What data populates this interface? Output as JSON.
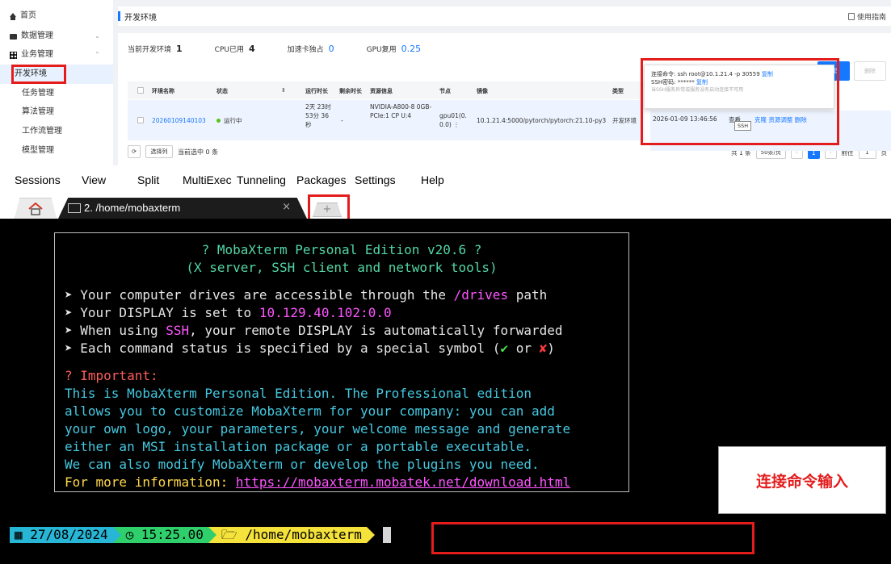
{
  "sidebar": {
    "items": [
      {
        "label": "首页",
        "icon": "home-icon"
      },
      {
        "label": "数据管理",
        "icon": "folder-icon"
      },
      {
        "label": "业务管理",
        "icon": "grid-icon"
      },
      {
        "label": "开发环境"
      },
      {
        "label": "任务管理"
      },
      {
        "label": "算法管理"
      },
      {
        "label": "工作流管理"
      },
      {
        "label": "模型管理"
      }
    ]
  },
  "header": {
    "title": "开发环境",
    "help": "使用指南"
  },
  "stats": {
    "env_label": "当前开发环境",
    "env_value": "1",
    "cpu_label": "CPU已用",
    "cpu_value": "4",
    "acc_label": "加速卡独占",
    "acc_value": "0",
    "gpu_label": "GPU复用",
    "gpu_value": "0.25"
  },
  "table": {
    "headers": [
      "环境名称",
      "状态",
      "运行时长",
      "剩余时长",
      "资源信息",
      "节点",
      "镜像",
      "类型"
    ],
    "row": {
      "name": "20260109140103",
      "status": "运行中",
      "runtime": "2天 23时 53分 36 秒",
      "remaining": "-",
      "resource": "NVIDIA-A800-8 0GB-PCIe:1 CP U:4",
      "node": "gpu01(0. 0.0) ⋮",
      "image": "10.1.21.4:5000/pytorch/pytorch:21.10-py3",
      "type": "开发环境",
      "created": "2026-01-09 13:46:56",
      "view": "查看",
      "actions": "克隆 资源调整 删除"
    }
  },
  "popup": {
    "cmd_label": "连接命令:",
    "cmd_value": "ssh root@10.1.21.4 -p 30559",
    "copy": "复制",
    "pwd_label": "SSH密码:",
    "pwd_value": "******",
    "hint": "当SSH服务异常或服务没有启动连接不可用"
  },
  "tooltip": "SSH",
  "buttons": {
    "create": "新建",
    "delete": "删除"
  },
  "footer": {
    "refresh": "⟳",
    "select_col": "选择列",
    "selected": "当前选中 0 条",
    "total": "共 1 条",
    "page_size": "50条/页",
    "page": "1",
    "goto": "前往",
    "goto_value": "1",
    "page_suffix": "页"
  },
  "menubar": [
    "Sessions",
    "View",
    "Split",
    "MultiExec",
    "Tunneling",
    "Packages",
    "Settings",
    "Help"
  ],
  "tabs": {
    "term_label": "2. /home/mobaxterm",
    "close": "×",
    "new": "+"
  },
  "banner": {
    "title": "? MobaXterm Personal Edition v20.6 ?",
    "subtitle": "(X server, SSH client and network tools)",
    "l1a": "➤ Your computer drives are accessible through the ",
    "l1b": "/drives",
    "l1c": " path",
    "l2a": "➤ Your DISPLAY is set to ",
    "l2b": "10.129.40.102:0.0",
    "l3a": "➤ When using ",
    "l3b": "SSH",
    "l3c": ", your remote DISPLAY is automatically forwarded",
    "l4a": "➤ Each command status is specified by a special symbol (",
    "l4b": "✔",
    "l4c": " or ",
    "l4d": "✘",
    "l4e": ")",
    "important": "? Important:",
    "p1": "This is MobaXterm Personal Edition. The Professional edition",
    "p2": "allows you to customize MobaXterm for your company: you can add",
    "p3": "your own logo, your parameters, your welcome message and generate",
    "p4": "either an MSI installation package or a portable executable.",
    "p5": "We can also modify MobaXterm or develop the plugins you need.",
    "p6a": "For more information: ",
    "p6b": "https://mobaxterm.mobatek.net/download.html"
  },
  "prompt": {
    "date": "27/08/2024",
    "time": "15:25.00",
    "path": "/home/mobaxterm"
  },
  "annotation": "连接命令输入",
  "colors": {
    "accent": "#1677ff",
    "highlight": "#e41c1c"
  }
}
